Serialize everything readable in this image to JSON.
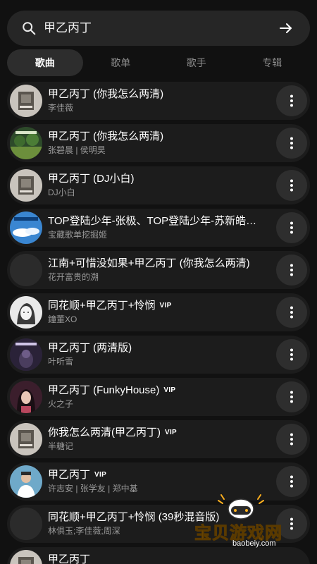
{
  "search": {
    "query": "甲乙丙丁"
  },
  "tabs": [
    {
      "label": "歌曲",
      "active": true
    },
    {
      "label": "歌单",
      "active": false
    },
    {
      "label": "歌手",
      "active": false
    },
    {
      "label": "专辑",
      "active": false
    }
  ],
  "songs": [
    {
      "title": "甲乙丙丁 (你我怎么两清)",
      "artist": "李佳薇",
      "vip": "",
      "cover": "grey-mono"
    },
    {
      "title": "甲乙丙丁 (你我怎么两清)",
      "artist": "张碧晨 | 侯明昊",
      "vip": "",
      "cover": "green-landscape"
    },
    {
      "title": "甲乙丙丁 (DJ小白)",
      "artist": "DJ小白",
      "vip": "",
      "cover": "grey-mono"
    },
    {
      "title": "TOP登陆少年-张极、TOP登陆少年-苏新皓…",
      "artist": "宝藏歌单挖掘姬",
      "vip": "",
      "cover": "blue-sky"
    },
    {
      "title": "江南+可惜没如果+甲乙丙丁 (你我怎么两清)",
      "artist": "花开富贵的溯",
      "vip": "",
      "cover": "blank"
    },
    {
      "title": "同花顺+甲乙丙丁+怜悯",
      "artist": "鐘董XO",
      "vip": "VIP",
      "cover": "sketch-portrait"
    },
    {
      "title": "甲乙丙丁 (两清版)",
      "artist": "叶听雪",
      "vip": "",
      "cover": "dark-purple"
    },
    {
      "title": "甲乙丙丁 (FunkyHouse)",
      "artist": "火之子",
      "vip": "VIP",
      "cover": "portrait-woman"
    },
    {
      "title": "你我怎么两清(甲乙丙丁)",
      "artist": "半糖记",
      "vip": "VIP",
      "cover": "grey-mono"
    },
    {
      "title": "甲乙丙丁",
      "artist": "许志安 | 张学友 | 郑中基",
      "vip": "VIP",
      "cover": "blue-portrait"
    },
    {
      "title": "同花顺+甲乙丙丁+怜悯 (39秒混音版)",
      "artist": "林俱玉;李佳薇;周深",
      "vip": "",
      "cover": "blank"
    }
  ],
  "partial_song": {
    "title": "甲乙丙丁"
  },
  "watermark": {
    "text": "宝贝游戏网",
    "url": "baobeiy.com"
  },
  "icons": {
    "search": "search-icon",
    "go": "arrow-right-icon",
    "more": "more-vertical-icon"
  },
  "colors": {
    "background": "#111111",
    "row": "#1c1c1c",
    "watermark": "#ffb01e"
  }
}
